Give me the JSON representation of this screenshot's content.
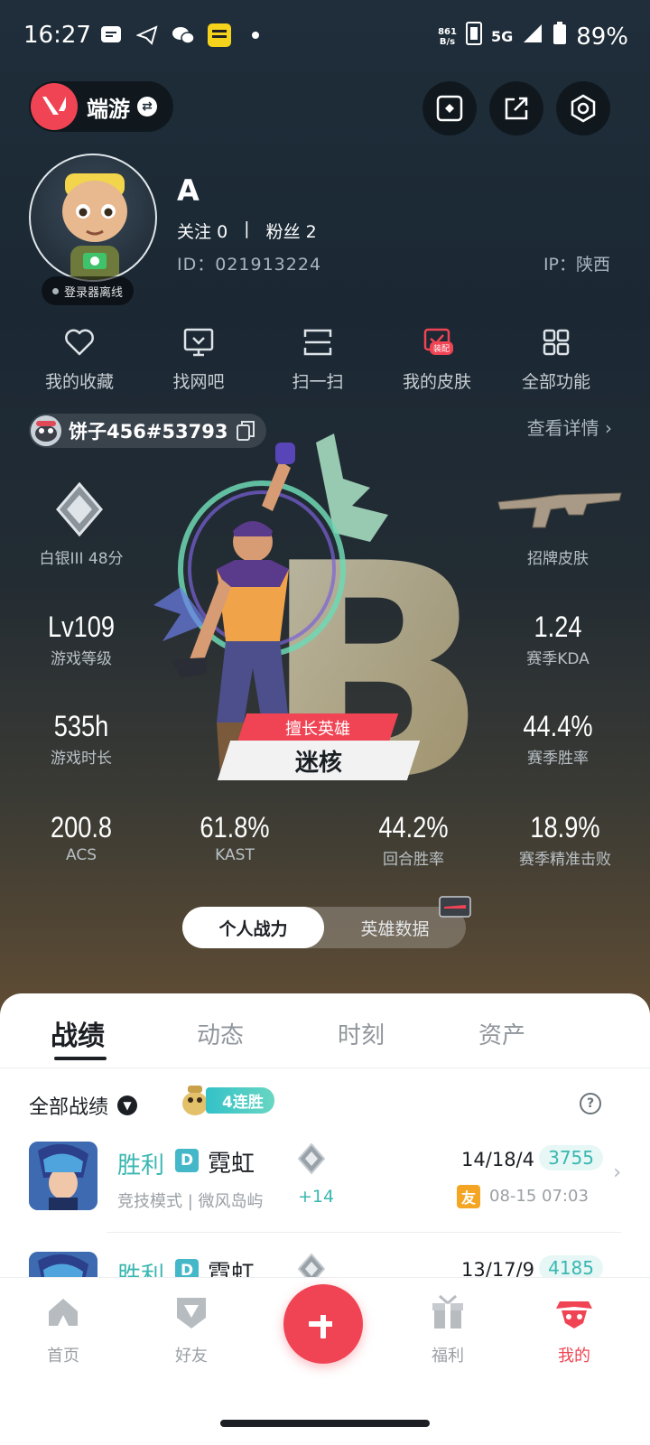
{
  "status_bar": {
    "time": "16:27",
    "net_speed_top": "861",
    "net_speed_bottom": "B/s",
    "network": "5G",
    "battery": "89%"
  },
  "header": {
    "game_name": "端游"
  },
  "profile": {
    "name": "A",
    "follow_label": "关注",
    "follow_count": "0",
    "separator": "|",
    "fans_label": "粉丝",
    "fans_count": "2",
    "id_text": "ID：021913224",
    "ip_text": "IP：陕西",
    "status": "登录器离线"
  },
  "quick_actions": [
    {
      "label": "我的收藏",
      "icon": "heart-icon"
    },
    {
      "label": "找网吧",
      "icon": "monitor-icon"
    },
    {
      "label": "扫一扫",
      "icon": "scan-icon"
    },
    {
      "label": "我的皮肤",
      "icon": "skin-icon",
      "badge": "装配"
    },
    {
      "label": "全部功能",
      "icon": "grid-icon"
    }
  ],
  "player": {
    "tag": "饼子456#53793",
    "view_detail": "查看详情"
  },
  "stats": {
    "rank_label": "白银III 48分",
    "skin_label": "招牌皮肤",
    "level_value": "Lv109",
    "level_label": "游戏等级",
    "kda_value": "1.24",
    "kda_label": "赛季KDA",
    "playtime_value": "535h",
    "playtime_label": "游戏时长",
    "winrate_value": "44.4%",
    "winrate_label": "赛季胜率",
    "acs_value": "200.8",
    "acs_label": "ACS",
    "kast_value": "61.8%",
    "kast_label": "KAST",
    "round_winrate_value": "44.2%",
    "round_winrate_label": "回合胜率",
    "precision_value": "18.9%",
    "precision_label": "赛季精准击败",
    "best_hero_tag": "擅长英雄",
    "best_hero_name": "迷核",
    "grade_letter": "B"
  },
  "toggle": {
    "personal": "个人战力",
    "hero_data": "英雄数据"
  },
  "tabs": [
    "战绩",
    "动态",
    "时刻",
    "资产"
  ],
  "records": {
    "filter_label": "全部战绩",
    "streak": "4连胜",
    "matches": [
      {
        "result": "胜利",
        "tier": "D",
        "hero": "霓虹",
        "mode": "竞技模式 | 微风岛屿",
        "points": "+14",
        "kda": "14/18/4",
        "score": "3755",
        "friend": "友",
        "time": "08-15 07:03"
      },
      {
        "result": "胜利",
        "tier": "D",
        "hero": "霓虹",
        "mode": "",
        "points": "",
        "kda": "13/17/9",
        "score": "4185",
        "friend": "",
        "time": ""
      }
    ]
  },
  "nav": {
    "home": "首页",
    "friends": "好友",
    "welfare": "福利",
    "mine": "我的"
  },
  "colors": {
    "accent": "#f04454",
    "win": "#3ab7b1"
  }
}
